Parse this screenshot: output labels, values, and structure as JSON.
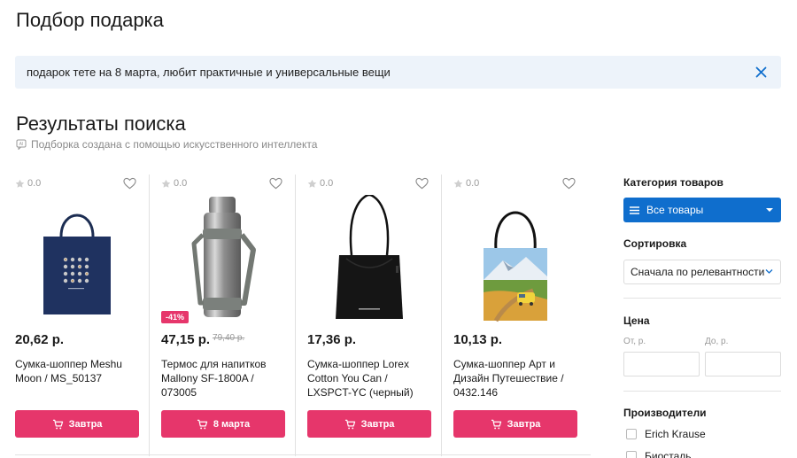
{
  "page": {
    "title": "Подбор подарка"
  },
  "search": {
    "query": "подарок тете на 8 марта, любит практичные и универсальные вещи"
  },
  "results": {
    "title": "Результаты поиска",
    "ai_note": "Подборка создана с помощью искусственного интеллекта"
  },
  "products": [
    {
      "rating": "0.0",
      "price": "20,62 р.",
      "old_price": "",
      "discount": "",
      "name": "Сумка-шоппер Meshu Moon / MS_50137",
      "button": "Завтра",
      "image": "navy-tote-bag"
    },
    {
      "rating": "0.0",
      "price": "47,15 р.",
      "old_price": "79,40 р.",
      "discount": "-41%",
      "name": "Термос для напитков Mallony SF-1800A / 073005",
      "button": "8 марта",
      "image": "steel-thermos"
    },
    {
      "rating": "0.0",
      "price": "17,36 р.",
      "old_price": "",
      "discount": "",
      "name": "Сумка-шоппер Lorex Cotton You Can / LXSPCT-YC (черный)",
      "button": "Завтра",
      "image": "black-tote-bag"
    },
    {
      "rating": "0.0",
      "price": "10,13 р.",
      "old_price": "",
      "discount": "",
      "name": "Сумка-шоппер Арт и Дизайн Путешествие / 0432.146",
      "button": "Завтра",
      "image": "landscape-tote-bag"
    }
  ],
  "filters": {
    "category_label": "Категория товаров",
    "category_value": "Все товары",
    "sort_label": "Сортировка",
    "sort_value": "Сначала по релевантности",
    "price_label": "Цена",
    "price_from_placeholder": "От, р.",
    "price_to_placeholder": "До, р.",
    "makers_label": "Производители",
    "makers": [
      "Erich Krause",
      "Биосталь"
    ]
  },
  "colors": {
    "accent_pink": "#e6366b",
    "accent_blue": "#0f6ecd",
    "search_bg": "#edf3fa"
  }
}
